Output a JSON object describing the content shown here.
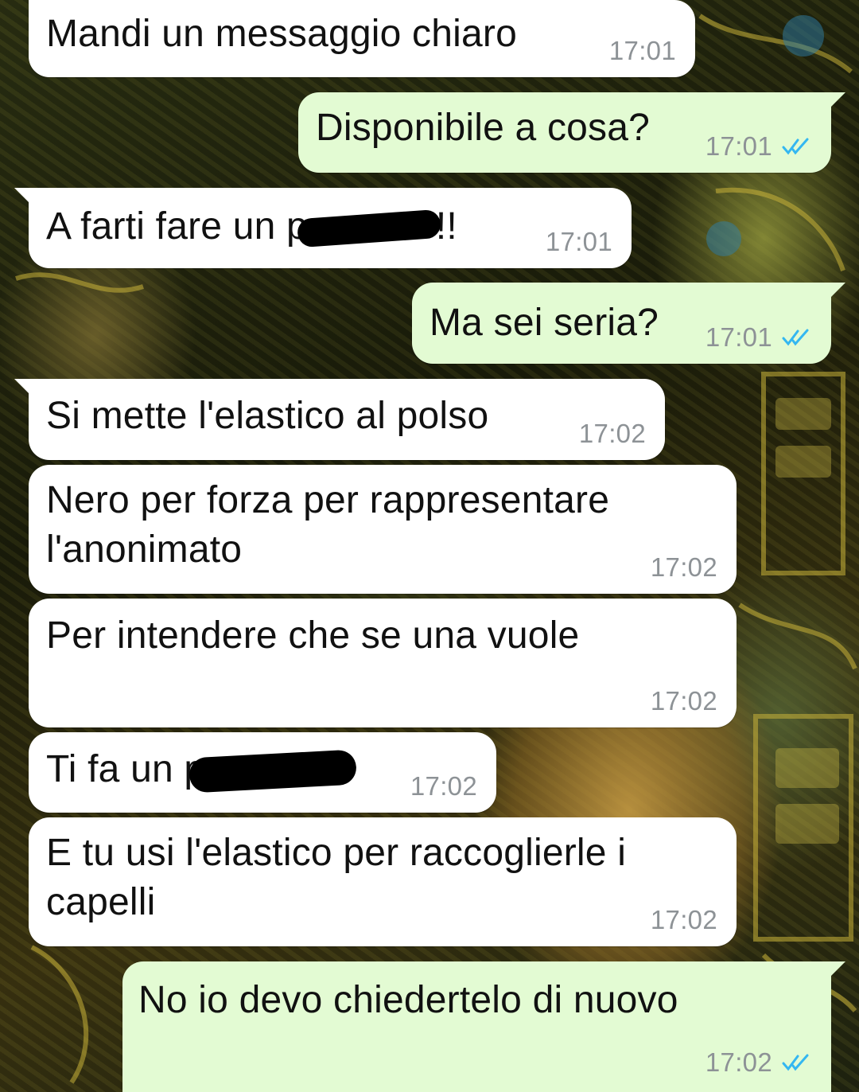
{
  "messages": [
    {
      "id": "m1",
      "direction": "incoming",
      "text": "Mandi un messaggio chiaro",
      "time": "17:01"
    },
    {
      "id": "m2",
      "direction": "outgoing",
      "text": "Disponibile a cosa?",
      "time": "17:01",
      "status": "read"
    },
    {
      "id": "m3",
      "direction": "incoming",
      "text_before": "A farti fare un po",
      "text_after": "!!",
      "redacted": true,
      "time": "17:01"
    },
    {
      "id": "m4",
      "direction": "outgoing",
      "text": "Ma sei seria?",
      "time": "17:01",
      "status": "read"
    },
    {
      "id": "m5",
      "direction": "incoming",
      "text": "Si mette l'elastico al polso",
      "time": "17:02"
    },
    {
      "id": "m6",
      "direction": "incoming",
      "lines": [
        "Nero per forza per rappresentare",
        "l'anonimato"
      ],
      "time": "17:02"
    },
    {
      "id": "m7",
      "direction": "incoming",
      "text": "Per intendere che se una vuole",
      "time": "17:02"
    },
    {
      "id": "m8",
      "direction": "incoming",
      "text_before": "Ti fa un p",
      "redacted": true,
      "time": "17:02"
    },
    {
      "id": "m9",
      "direction": "incoming",
      "lines": [
        "E tu usi l'elastico per raccoglierle i",
        "capelli"
      ],
      "time": "17:02"
    },
    {
      "id": "m10",
      "direction": "outgoing",
      "text": "No io devo chiedertelo di nuovo",
      "time": "17:02",
      "status": "read"
    }
  ],
  "colors": {
    "incoming_bubble": "#ffffff",
    "outgoing_bubble": "#e3fbd3",
    "timestamp": "#8d9296",
    "read_ticks": "#34b7f1"
  },
  "icons": {
    "read_receipt": "double-check-icon"
  }
}
